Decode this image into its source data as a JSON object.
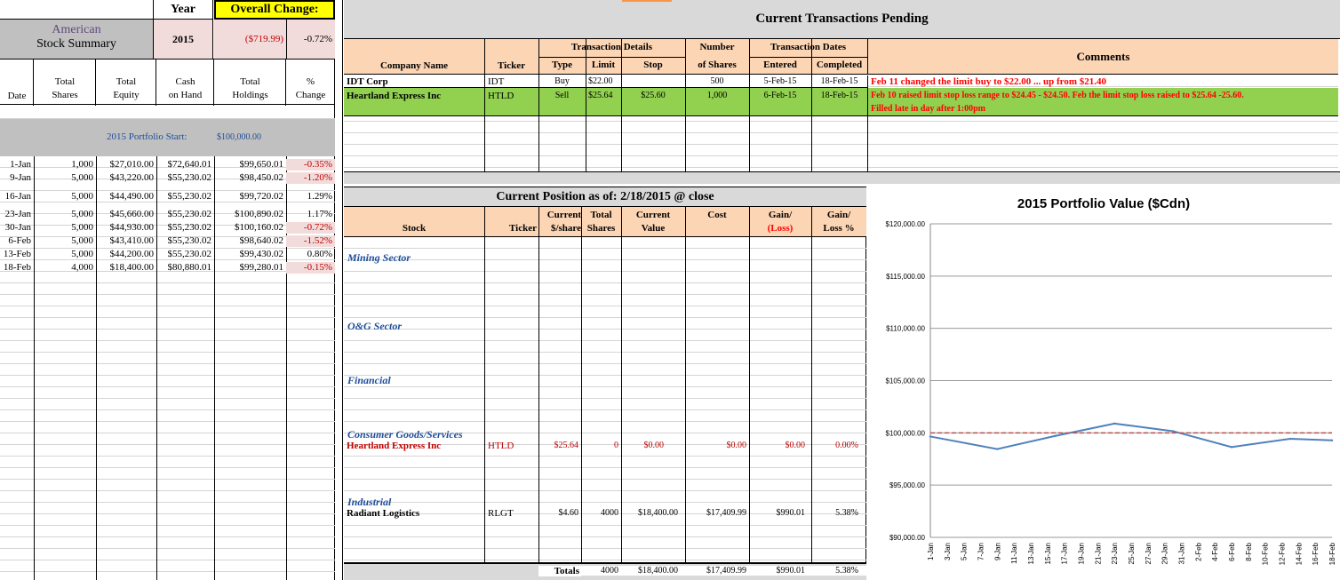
{
  "left": {
    "title_line1": "American",
    "title_line2": "Stock Summary",
    "year_label": "Year",
    "year_value": "2015",
    "overall_label": "Overall Change:",
    "overall_value": "($719.99)",
    "overall_pct": "-0.72%",
    "headers": {
      "date": "Date",
      "total_shares": [
        "Total",
        "Shares"
      ],
      "total_equity": [
        "Total",
        "Equity"
      ],
      "cash": [
        "Cash",
        "on Hand"
      ],
      "holdings": [
        "Total",
        "Holdings"
      ],
      "pct": [
        "%",
        "Change"
      ]
    },
    "portfolio_start_label": "2015 Portfolio Start:",
    "portfolio_start_value": "$100,000.00",
    "rows": [
      {
        "date": "1-Jan",
        "shares": "1,000",
        "equity": "$27,010.00",
        "cash": "$72,640.01",
        "holdings": "$99,650.01",
        "pct": "-0.35%",
        "neg": true
      },
      {
        "date": "9-Jan",
        "shares": "5,000",
        "equity": "$43,220.00",
        "cash": "$55,230.02",
        "holdings": "$98,450.02",
        "pct": "-1.20%",
        "neg": true
      },
      {
        "date": "16-Jan",
        "shares": "5,000",
        "equity": "$44,490.00",
        "cash": "$55,230.02",
        "holdings": "$99,720.02",
        "pct": "1.29%",
        "neg": false
      },
      {
        "date": "23-Jan",
        "shares": "5,000",
        "equity": "$45,660.00",
        "cash": "$55,230.02",
        "holdings": "$100,890.02",
        "pct": "1.17%",
        "neg": false
      },
      {
        "date": "30-Jan",
        "shares": "5,000",
        "equity": "$44,930.00",
        "cash": "$55,230.02",
        "holdings": "$100,160.02",
        "pct": "-0.72%",
        "neg": true
      },
      {
        "date": "6-Feb",
        "shares": "5,000",
        "equity": "$43,410.00",
        "cash": "$55,230.02",
        "holdings": "$98,640.02",
        "pct": "-1.52%",
        "neg": true
      },
      {
        "date": "13-Feb",
        "shares": "5,000",
        "equity": "$44,200.00",
        "cash": "$55,230.02",
        "holdings": "$99,430.02",
        "pct": "0.80%",
        "neg": false
      },
      {
        "date": "18-Feb",
        "shares": "4,000",
        "equity": "$18,400.00",
        "cash": "$80,880.01",
        "holdings": "$99,280.01",
        "pct": "-0.15%",
        "neg": true
      }
    ]
  },
  "transactions": {
    "title": "Current Transactions Pending",
    "headers": {
      "company": "Company Name",
      "ticker": "Ticker",
      "details": "Transaction Details",
      "type": "Type",
      "limit": "Limit",
      "stop": "Stop",
      "number": [
        "Number",
        "of Shares"
      ],
      "dates": "Transaction Dates",
      "entered": "Entered",
      "completed": "Completed",
      "comments": "Comments"
    },
    "rows": [
      {
        "company": "IDT Corp",
        "ticker": "IDT",
        "type": "Buy",
        "limit": "$22.00",
        "stop": "",
        "shares": "500",
        "entered": "5-Feb-15",
        "completed": "18-Feb-15",
        "comment": "Feb 11 changed the limit buy to $22.00 ... up from $21.40",
        "comment2": ""
      },
      {
        "company": "Heartland Express Inc",
        "ticker": "HTLD",
        "type": "Sell",
        "limit": "$25.64",
        "stop": "$25.60",
        "shares": "1,000",
        "entered": "6-Feb-15",
        "completed": "18-Feb-15",
        "comment": "Feb 10 raised limit stop loss range to $24.45 - $24.50. Feb the limit stop loss raised to $25.64 -25.60.",
        "comment2": "Filled late in day after 1:00pm"
      }
    ]
  },
  "position": {
    "title": "Current Position as of:  2/18/2015 @ close",
    "headers": {
      "stock": "Stock",
      "ticker": "Ticker",
      "current_share": [
        "Current",
        "$/share"
      ],
      "total_shares": [
        "Total",
        "Shares"
      ],
      "current_value": [
        "Current",
        "Value"
      ],
      "cost": "Cost",
      "gain": [
        "Gain/",
        "(Loss)"
      ],
      "gain_pct": [
        "Gain/",
        "Loss %"
      ]
    },
    "sectors": {
      "mining": "Mining Sector",
      "oag": "O&G Sector",
      "financial": "Financial",
      "consumer": "Consumer Goods/Services",
      "industrial": "Industrial"
    },
    "holdings": [
      {
        "stock": "Heartland Express Inc",
        "ticker": "HTLD",
        "price": "$25.64",
        "shares": "0",
        "value": "$0.00",
        "cost": "$0.00",
        "gain": "$0.00",
        "gain_pct": "0.00%"
      },
      {
        "stock": "Radiant Logistics",
        "ticker": "RLGT",
        "price": "$4.60",
        "shares": "4000",
        "value": "$18,400.00",
        "cost": "$17,409.99",
        "gain": "$990.01",
        "gain_pct": "5.38%"
      }
    ],
    "totals": {
      "label": "Totals",
      "shares": "4000",
      "value": "$18,400.00",
      "cost": "$17,409.99",
      "gain": "$990.01",
      "gain_pct": "5.38%"
    }
  },
  "chart_data": {
    "type": "line",
    "title": "2015 Portfolio Value ($Cdn)",
    "y_tick_labels": [
      "$120,000.00",
      "$115,000.00",
      "$110,000.00",
      "$105,000.00",
      "$100,000.00",
      "$95,000.00",
      "$90,000.00"
    ],
    "ylim": [
      90000,
      120000
    ],
    "x_tick_labels": [
      "1-Jan",
      "3-Jan",
      "5-Jan",
      "7-Jan",
      "9-Jan",
      "11-Jan",
      "13-Jan",
      "15-Jan",
      "17-Jan",
      "19-Jan",
      "21-Jan",
      "23-Jan",
      "25-Jan",
      "27-Jan",
      "29-Jan",
      "31-Jan",
      "2-Feb",
      "4-Feb",
      "6-Feb",
      "8-Feb",
      "10-Feb",
      "12-Feb",
      "14-Feb",
      "16-Feb",
      "18-Feb"
    ],
    "series": [
      {
        "x": [
          "1-Jan",
          "9-Jan",
          "16-Jan",
          "23-Jan",
          "30-Jan",
          "6-Feb",
          "13-Feb",
          "18-Feb"
        ],
        "values": [
          99650.01,
          98450.02,
          99720.02,
          100890.02,
          100160.02,
          98640.02,
          99430.02,
          99280.01
        ],
        "color": "#4f81bd",
        "style": "solid"
      },
      {
        "x": [
          "1-Jan",
          "18-Feb"
        ],
        "values": [
          100000,
          100000
        ],
        "color": "#c0504d",
        "style": "dashed"
      }
    ],
    "grid": true
  }
}
